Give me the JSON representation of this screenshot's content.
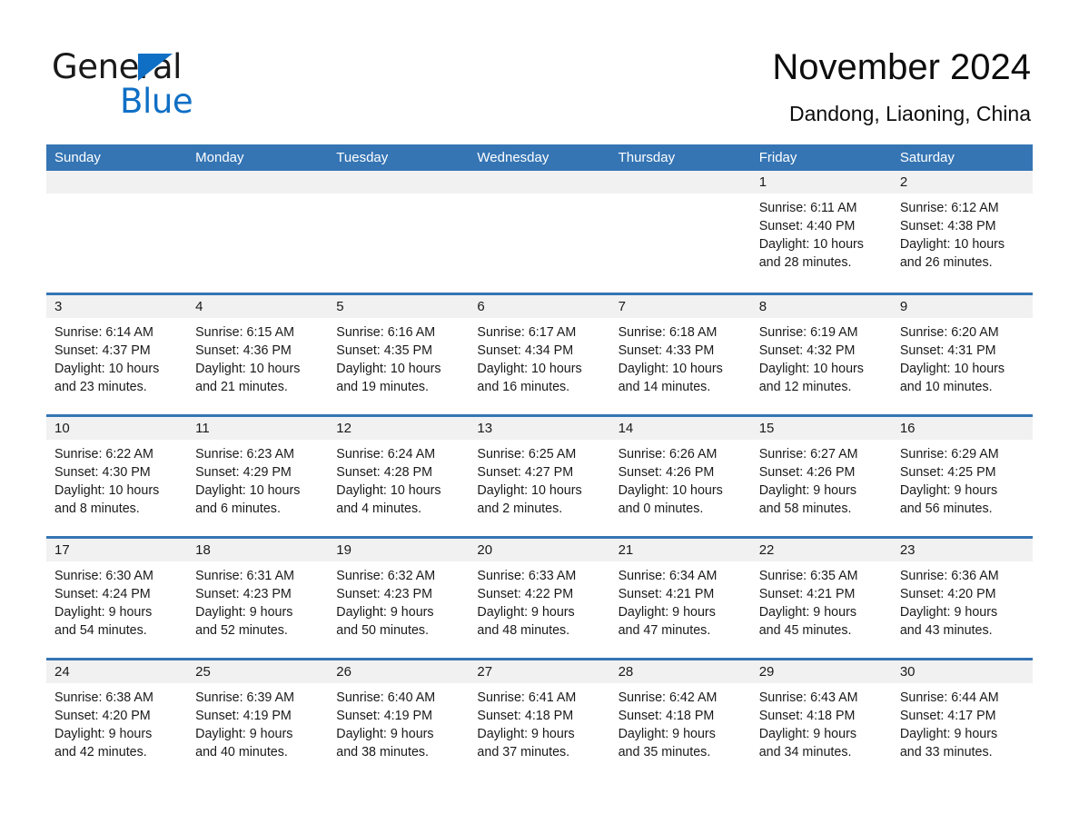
{
  "brand": {
    "name_part1": "General",
    "name_part2": "Blue",
    "triangle_color": "#0f6fc5",
    "text_color": "#1a1a1a"
  },
  "header": {
    "title": "November 2024",
    "subtitle": "Dandong, Liaoning, China"
  },
  "theme": {
    "header_band": "#3575b4",
    "day_band": "#f1f1f1",
    "row_rule": "#3575b4",
    "page_background": "#ffffff"
  },
  "weekdays": [
    "Sunday",
    "Monday",
    "Tuesday",
    "Wednesday",
    "Thursday",
    "Friday",
    "Saturday"
  ],
  "weeks": [
    [
      {
        "day": "",
        "lines": []
      },
      {
        "day": "",
        "lines": []
      },
      {
        "day": "",
        "lines": []
      },
      {
        "day": "",
        "lines": []
      },
      {
        "day": "",
        "lines": []
      },
      {
        "day": "1",
        "lines": [
          "Sunrise: 6:11 AM",
          "Sunset: 4:40 PM",
          "Daylight: 10 hours",
          "and 28 minutes."
        ]
      },
      {
        "day": "2",
        "lines": [
          "Sunrise: 6:12 AM",
          "Sunset: 4:38 PM",
          "Daylight: 10 hours",
          "and 26 minutes."
        ]
      }
    ],
    [
      {
        "day": "3",
        "lines": [
          "Sunrise: 6:14 AM",
          "Sunset: 4:37 PM",
          "Daylight: 10 hours",
          "and 23 minutes."
        ]
      },
      {
        "day": "4",
        "lines": [
          "Sunrise: 6:15 AM",
          "Sunset: 4:36 PM",
          "Daylight: 10 hours",
          "and 21 minutes."
        ]
      },
      {
        "day": "5",
        "lines": [
          "Sunrise: 6:16 AM",
          "Sunset: 4:35 PM",
          "Daylight: 10 hours",
          "and 19 minutes."
        ]
      },
      {
        "day": "6",
        "lines": [
          "Sunrise: 6:17 AM",
          "Sunset: 4:34 PM",
          "Daylight: 10 hours",
          "and 16 minutes."
        ]
      },
      {
        "day": "7",
        "lines": [
          "Sunrise: 6:18 AM",
          "Sunset: 4:33 PM",
          "Daylight: 10 hours",
          "and 14 minutes."
        ]
      },
      {
        "day": "8",
        "lines": [
          "Sunrise: 6:19 AM",
          "Sunset: 4:32 PM",
          "Daylight: 10 hours",
          "and 12 minutes."
        ]
      },
      {
        "day": "9",
        "lines": [
          "Sunrise: 6:20 AM",
          "Sunset: 4:31 PM",
          "Daylight: 10 hours",
          "and 10 minutes."
        ]
      }
    ],
    [
      {
        "day": "10",
        "lines": [
          "Sunrise: 6:22 AM",
          "Sunset: 4:30 PM",
          "Daylight: 10 hours",
          "and 8 minutes."
        ]
      },
      {
        "day": "11",
        "lines": [
          "Sunrise: 6:23 AM",
          "Sunset: 4:29 PM",
          "Daylight: 10 hours",
          "and 6 minutes."
        ]
      },
      {
        "day": "12",
        "lines": [
          "Sunrise: 6:24 AM",
          "Sunset: 4:28 PM",
          "Daylight: 10 hours",
          "and 4 minutes."
        ]
      },
      {
        "day": "13",
        "lines": [
          "Sunrise: 6:25 AM",
          "Sunset: 4:27 PM",
          "Daylight: 10 hours",
          "and 2 minutes."
        ]
      },
      {
        "day": "14",
        "lines": [
          "Sunrise: 6:26 AM",
          "Sunset: 4:26 PM",
          "Daylight: 10 hours",
          "and 0 minutes."
        ]
      },
      {
        "day": "15",
        "lines": [
          "Sunrise: 6:27 AM",
          "Sunset: 4:26 PM",
          "Daylight: 9 hours",
          "and 58 minutes."
        ]
      },
      {
        "day": "16",
        "lines": [
          "Sunrise: 6:29 AM",
          "Sunset: 4:25 PM",
          "Daylight: 9 hours",
          "and 56 minutes."
        ]
      }
    ],
    [
      {
        "day": "17",
        "lines": [
          "Sunrise: 6:30 AM",
          "Sunset: 4:24 PM",
          "Daylight: 9 hours",
          "and 54 minutes."
        ]
      },
      {
        "day": "18",
        "lines": [
          "Sunrise: 6:31 AM",
          "Sunset: 4:23 PM",
          "Daylight: 9 hours",
          "and 52 minutes."
        ]
      },
      {
        "day": "19",
        "lines": [
          "Sunrise: 6:32 AM",
          "Sunset: 4:23 PM",
          "Daylight: 9 hours",
          "and 50 minutes."
        ]
      },
      {
        "day": "20",
        "lines": [
          "Sunrise: 6:33 AM",
          "Sunset: 4:22 PM",
          "Daylight: 9 hours",
          "and 48 minutes."
        ]
      },
      {
        "day": "21",
        "lines": [
          "Sunrise: 6:34 AM",
          "Sunset: 4:21 PM",
          "Daylight: 9 hours",
          "and 47 minutes."
        ]
      },
      {
        "day": "22",
        "lines": [
          "Sunrise: 6:35 AM",
          "Sunset: 4:21 PM",
          "Daylight: 9 hours",
          "and 45 minutes."
        ]
      },
      {
        "day": "23",
        "lines": [
          "Sunrise: 6:36 AM",
          "Sunset: 4:20 PM",
          "Daylight: 9 hours",
          "and 43 minutes."
        ]
      }
    ],
    [
      {
        "day": "24",
        "lines": [
          "Sunrise: 6:38 AM",
          "Sunset: 4:20 PM",
          "Daylight: 9 hours",
          "and 42 minutes."
        ]
      },
      {
        "day": "25",
        "lines": [
          "Sunrise: 6:39 AM",
          "Sunset: 4:19 PM",
          "Daylight: 9 hours",
          "and 40 minutes."
        ]
      },
      {
        "day": "26",
        "lines": [
          "Sunrise: 6:40 AM",
          "Sunset: 4:19 PM",
          "Daylight: 9 hours",
          "and 38 minutes."
        ]
      },
      {
        "day": "27",
        "lines": [
          "Sunrise: 6:41 AM",
          "Sunset: 4:18 PM",
          "Daylight: 9 hours",
          "and 37 minutes."
        ]
      },
      {
        "day": "28",
        "lines": [
          "Sunrise: 6:42 AM",
          "Sunset: 4:18 PM",
          "Daylight: 9 hours",
          "and 35 minutes."
        ]
      },
      {
        "day": "29",
        "lines": [
          "Sunrise: 6:43 AM",
          "Sunset: 4:18 PM",
          "Daylight: 9 hours",
          "and 34 minutes."
        ]
      },
      {
        "day": "30",
        "lines": [
          "Sunrise: 6:44 AM",
          "Sunset: 4:17 PM",
          "Daylight: 9 hours",
          "and 33 minutes."
        ]
      }
    ]
  ]
}
